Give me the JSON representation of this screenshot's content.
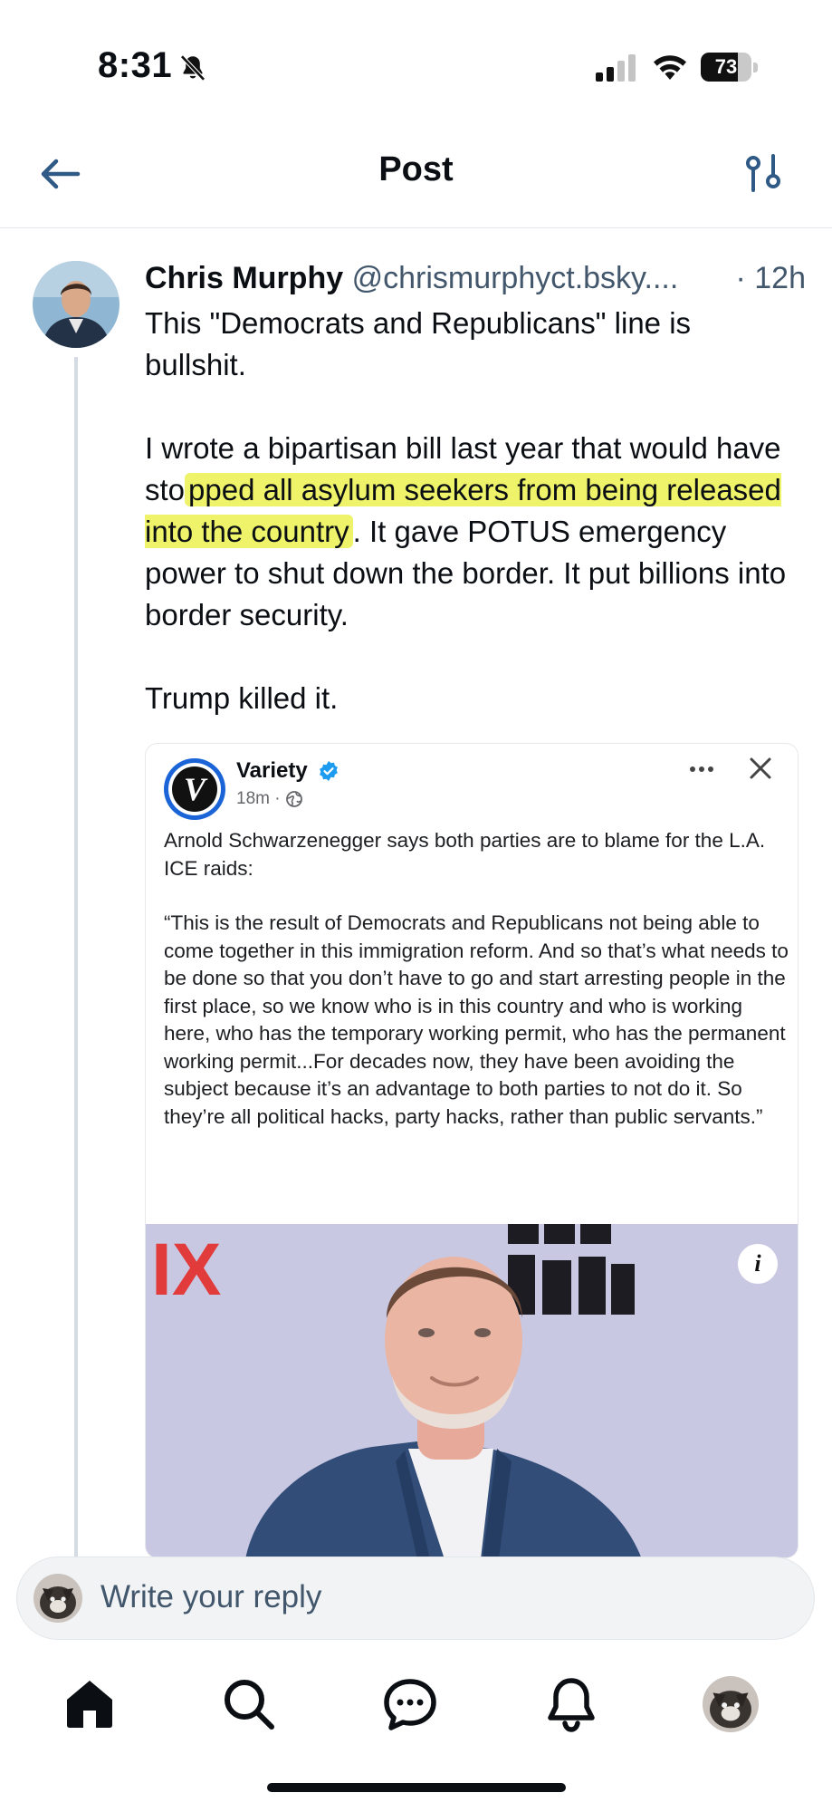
{
  "status_bar": {
    "time": "8:31",
    "battery": "73",
    "battery_level": 0.73
  },
  "header": {
    "title": "Post"
  },
  "post": {
    "author_name": "Chris Murphy",
    "handle": "@chrismurphyct.bsky....",
    "time": "· 12h",
    "paragraphs": {
      "p1": "This \"Democrats and Republicans\" line is bullshit.",
      "p2_before": "I wrote a bipartisan bill last year that would have sto",
      "p2_highlight": "pped all asylum seekers from being released into the country",
      "p2_after": ". It gave POTUS emergency power to shut down the border. It put billions into border security.",
      "p3": "Trump killed it."
    },
    "embed": {
      "source_name": "Variety",
      "source_meta": "18m ·",
      "logo_letter": "V",
      "text_1": "Arnold Schwarzenegger says both parties are to blame for the L.A. ICE raids:",
      "text_2": "“This is the result of Democrats and Republicans not being able to come together in this immigration reform. And so that’s what needs to be done so that you don’t have to go and start arresting people in the first place, so we know who is in this country and who is working here, who has the temporary working permit, who has the permanent working permit...For decades now, they have been avoiding the subject because it’s an advantage to both parties to not do it. So they’re all political hacks, party hacks, rather than public servants.”",
      "info_label": "i"
    }
  },
  "reply": {
    "placeholder": "Write your reply"
  },
  "tabs": {
    "items": [
      "home-icon",
      "search-icon",
      "chat-icon",
      "bell-icon",
      "profile-avatar"
    ],
    "active": "home-icon"
  },
  "colors": {
    "text_primary": "#0b0f14",
    "text_secondary": "#42576c",
    "highlight": "#eef36a",
    "verified": "#1d9bf0",
    "back_arrow": "#2f5a85"
  }
}
